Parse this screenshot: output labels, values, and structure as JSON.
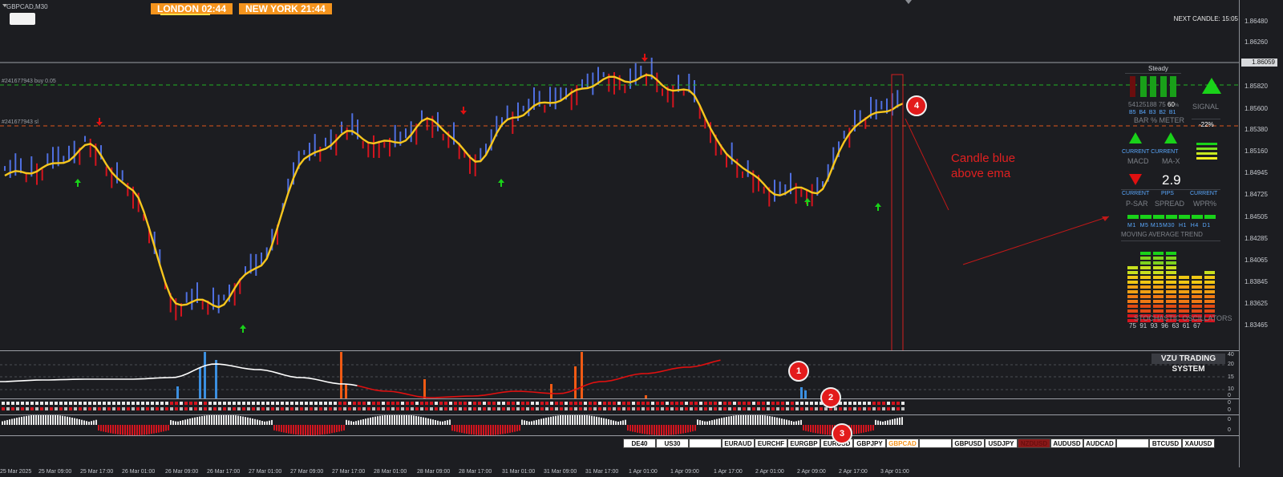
{
  "window": {
    "symbol_title": "GBPCAD,M30"
  },
  "sessions": [
    {
      "label": "LONDON  02:44"
    },
    {
      "label": "NEW YORK  21:44"
    }
  ],
  "next_candle": "NEXT CANDLE: 15:05",
  "orders": {
    "buy_label": "#241677943 buy 0.05",
    "sl_label": "#241677943 sl"
  },
  "price_axis": {
    "labels": [
      "1.86480",
      "1.86260",
      "1.85820",
      "1.85600",
      "1.85380",
      "1.85160",
      "1.84945",
      "1.84725",
      "1.84505",
      "1.84285",
      "1.84065",
      "1.83845",
      "1.83625",
      "1.83465"
    ],
    "current": "1.86059"
  },
  "sub_axis": {
    "osc_labels": [
      "40",
      "20",
      "15",
      "10",
      "0"
    ],
    "strip_labels": [
      "0",
      "0",
      "0",
      "0"
    ]
  },
  "indicator": {
    "title": "VZU TRADING SYSTEM"
  },
  "annotation": {
    "line1": "Candle blue",
    "line2": "above ema"
  },
  "badges": [
    "1",
    "2",
    "3",
    "4"
  ],
  "panel": {
    "state": "Steady",
    "bar_values": [
      "54",
      "12",
      "51",
      "88",
      "75"
    ],
    "bar_pct": "60",
    "pct_unit": "%",
    "bar_labels": [
      "B5",
      "B4",
      "B3",
      "B2",
      "B1"
    ],
    "bar_meter_title": "BAR % METER",
    "signal_label": "SIGNAL",
    "signal_pct": "-22%",
    "macd_current": "CURRENT",
    "macd_label": "MACD",
    "max_current": "CURRENT",
    "max_label": "MA-X",
    "spread_value": "2.9",
    "psar_current": "CURRENT",
    "psar_label": "P-SAR",
    "pips_label": "PIPS",
    "spread_label": "SPREAD",
    "wpr_current": "CURRENT",
    "wpr_label": "WPR%",
    "tf_labels": [
      "M1",
      "M5",
      "M15",
      "M30",
      "H1",
      "H4",
      "D1"
    ],
    "ma_trend_title": "MOVING AVERAGE TREND",
    "stoch_values": [
      "75",
      "91",
      "93",
      "96",
      "63",
      "61",
      "67"
    ],
    "stoch_title": "STOCHASTIC OSCILLATORS",
    "colors": {
      "up": "#19d219",
      "down": "#e01010",
      "bar_dark": "#6b0e0e"
    }
  },
  "symbols": [
    "DE40",
    "US30",
    "",
    "EURAUD",
    "EURCHF",
    "EURGBP",
    "EURUSD",
    "GBPJPY",
    "GBPCAD",
    "",
    "GBPUSD",
    "USDJPY",
    "NZDUSD",
    "AUDUSD",
    "AUDCAD",
    "",
    "BTCUSD",
    "XAUUSD"
  ],
  "active_symbol": "GBPCAD",
  "time_axis": [
    "25 Mar 2025",
    "25 Mar 09:00",
    "25 Mar 17:00",
    "26 Mar 01:00",
    "26 Mar 09:00",
    "26 Mar 17:00",
    "27 Mar 01:00",
    "27 Mar 09:00",
    "27 Mar 17:00",
    "28 Mar 01:00",
    "28 Mar 09:00",
    "28 Mar 17:00",
    "31 Mar 01:00",
    "31 Mar 09:00",
    "31 Mar 17:00",
    "1 Apr 01:00",
    "1 Apr 09:00",
    "1 Apr 17:00",
    "2 Apr 01:00",
    "2 Apr 09:00",
    "2 Apr 17:00",
    "3 Apr 01:00"
  ],
  "chart_data": {
    "type": "line",
    "symbol": "GBPCAD",
    "timeframe": "M30",
    "x": [
      "25 Mar 2025",
      "25 Mar 09:00",
      "25 Mar 17:00",
      "26 Mar 01:00",
      "26 Mar 09:00",
      "26 Mar 17:00",
      "27 Mar 01:00",
      "27 Mar 09:00",
      "27 Mar 17:00",
      "28 Mar 01:00",
      "28 Mar 09:00",
      "28 Mar 17:00",
      "31 Mar 01:00",
      "31 Mar 09:00",
      "31 Mar 17:00",
      "1 Apr 01:00",
      "1 Apr 09:00",
      "1 Apr 17:00",
      "2 Apr 01:00",
      "2 Apr 09:00",
      "2 Apr 17:00",
      "3 Apr 01:00"
    ],
    "series": [
      {
        "name": "",
        "color": "#f7c61d",
        "values": [
          1.8494,
          1.8502,
          1.8522,
          1.8478,
          1.837,
          1.8368,
          1.8408,
          1.851,
          1.8535,
          1.8525,
          1.8548,
          1.851,
          1.8555,
          1.857,
          1.8588,
          1.859,
          1.8575,
          1.851,
          1.8478,
          1.848,
          1.8548,
          1.8565
        ]
      }
    ],
    "ylim": [
      1.83465,
      1.8648
    ],
    "buy_level": 1.8582,
    "sl_level": 1.8538,
    "current_price": 1.86059
  }
}
